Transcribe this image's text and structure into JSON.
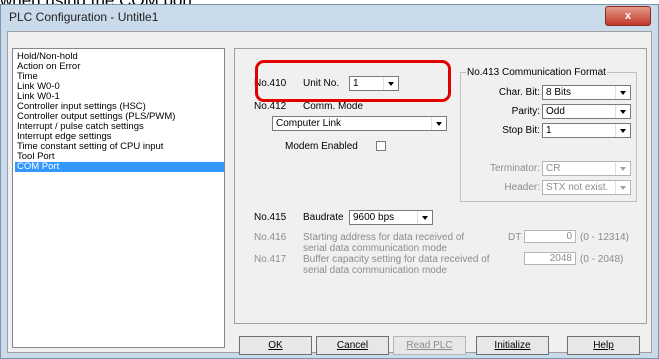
{
  "caption": "when using the COM port.",
  "window": {
    "title": "PLC Configuration - Untitle1",
    "close_label": "x"
  },
  "tree": {
    "items": [
      "Hold/Non-hold",
      "Action on Error",
      "Time",
      "Link W0-0",
      "Link W0-1",
      "Controller input settings (HSC)",
      "Controller output settings (PLS/PWM)",
      "Interrupt / pulse catch settings",
      "Interrupt edge settings",
      "Time constant setting of CPU input",
      "Tool Port",
      "COM Port"
    ],
    "selected": "COM Port"
  },
  "unit": {
    "no": "No.410",
    "label": "Unit No.",
    "value": "1"
  },
  "comm_mode": {
    "no": "No.412",
    "label": "Comm. Mode",
    "value": "Computer Link"
  },
  "modem": {
    "label": "Modem Enabled",
    "checked": false
  },
  "comm_format": {
    "title": "No.413 Communication Format",
    "char_bit_label": "Char. Bit:",
    "char_bit_value": "8 Bits",
    "parity_label": "Parity:",
    "parity_value": "Odd",
    "stop_bit_label": "Stop Bit:",
    "stop_bit_value": "1",
    "terminator_label": "Terminator:",
    "terminator_value": "CR",
    "header_label": "Header:",
    "header_value": "STX not exist."
  },
  "baudrate": {
    "no": "No.415",
    "label": "Baudrate",
    "value": "9600 bps"
  },
  "start_address": {
    "no": "No.416",
    "line1": "Starting address for data received of",
    "line2": "serial data communication mode",
    "prefix": "DT",
    "value": "0",
    "range": "(0 - 12314)"
  },
  "buffer_capacity": {
    "no": "No.417",
    "line1": "Buffer capacity setting for data received of",
    "line2": "serial data communication mode",
    "value": "2048",
    "range": "(0 - 2048)"
  },
  "buttons": {
    "ok": "OK",
    "cancel": "Cancel",
    "read_plc": "Read PLC",
    "initialize": "Initialize",
    "help": "Help"
  }
}
